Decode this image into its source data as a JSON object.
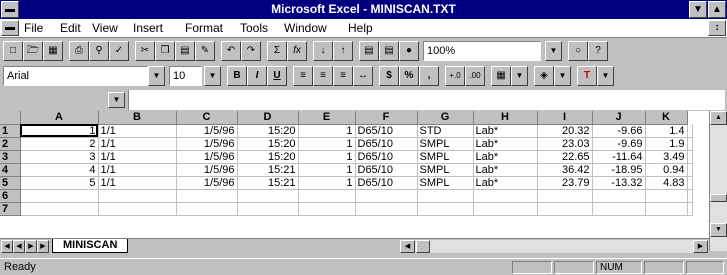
{
  "window": {
    "title": "Microsoft Excel - MINISCAN.TXT"
  },
  "menu": {
    "file": "File",
    "edit": "Edit",
    "view": "View",
    "insert": "Insert",
    "format": "Format",
    "tools": "Tools",
    "window": "Window",
    "help": "Help"
  },
  "toolbar": {
    "zoom": "100%",
    "sum_label": "Σ",
    "fx_label": "fx"
  },
  "formatting": {
    "font_name": "Arial",
    "font_size": "10",
    "bold": "B",
    "italic": "I",
    "underline": "U",
    "currency": "$",
    "percent": "%",
    "comma": ",",
    "inc_decimal": "+.0",
    "dec_decimal": ".00"
  },
  "formula_bar": {
    "cell_reference": "",
    "content": ""
  },
  "columns": [
    "A",
    "B",
    "C",
    "D",
    "E",
    "F",
    "G",
    "H",
    "I",
    "J",
    "K"
  ],
  "rows": [
    {
      "num": "1",
      "cells": [
        "1",
        "1/1",
        "1/5/96",
        "15:20",
        "1",
        "D65/10",
        "STD",
        "Lab*",
        "20.32",
        "-9.66",
        "1.4"
      ]
    },
    {
      "num": "2",
      "cells": [
        "2",
        "1/1",
        "1/5/96",
        "15:20",
        "1",
        "D65/10",
        "SMPL",
        "Lab*",
        "23.03",
        "-9.69",
        "1.9"
      ]
    },
    {
      "num": "3",
      "cells": [
        "3",
        "1/1",
        "1/5/96",
        "15:20",
        "1",
        "D65/10",
        "SMPL",
        "Lab*",
        "22.65",
        "-11.64",
        "3.49"
      ]
    },
    {
      "num": "4",
      "cells": [
        "4",
        "1/1",
        "1/5/96",
        "15:21",
        "1",
        "D65/10",
        "SMPL",
        "Lab*",
        "36.42",
        "-18.95",
        "0.94"
      ]
    },
    {
      "num": "5",
      "cells": [
        "5",
        "1/1",
        "1/5/96",
        "15:21",
        "1",
        "D65/10",
        "SMPL",
        "Lab*",
        "23.79",
        "-13.32",
        "4.83"
      ]
    },
    {
      "num": "6",
      "cells": [
        "",
        "",
        "",
        "",
        "",
        "",
        "",
        "",
        "",
        "",
        ""
      ]
    },
    {
      "num": "7",
      "cells": [
        "",
        "",
        "",
        "",
        "",
        "",
        "",
        "",
        "",
        "",
        ""
      ]
    }
  ],
  "sheet_tab": "MINISCAN",
  "status": {
    "text": "Ready",
    "num_lock": "NUM"
  }
}
